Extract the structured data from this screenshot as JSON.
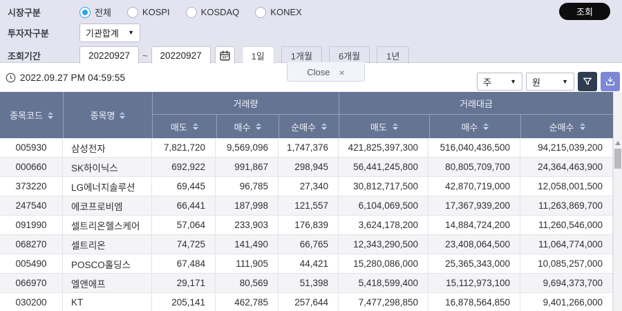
{
  "filters": {
    "market": {
      "label": "시장구분",
      "options": [
        {
          "label": "전체",
          "selected": true
        },
        {
          "label": "KOSPI",
          "selected": false
        },
        {
          "label": "KOSDAQ",
          "selected": false
        },
        {
          "label": "KONEX",
          "selected": false
        }
      ]
    },
    "investor": {
      "label": "투자자구분",
      "value": "기관합계"
    },
    "period": {
      "label": "조회기간",
      "start_date": "20220927",
      "separator": "~",
      "end_date": "20220927",
      "quick_buttons": [
        {
          "label": "1일",
          "active": true
        },
        {
          "label": "1개월",
          "active": false
        },
        {
          "label": "6개월",
          "active": false
        },
        {
          "label": "1년",
          "active": false
        }
      ]
    },
    "search_button_label": "조회"
  },
  "toolbar": {
    "timestamp": "2022.09.27 PM 04:59:55",
    "tab": {
      "label": "Close",
      "close_glyph": "×"
    },
    "unit_select_1": "주",
    "unit_select_2": "원"
  },
  "table": {
    "header": {
      "code": "종목코드",
      "name": "종목명",
      "volume_group": "거래량",
      "value_group": "거래대금",
      "sub_sell": "매도",
      "sub_buy": "매수",
      "sub_net": "순매수"
    },
    "rows": [
      {
        "code": "005930",
        "name": "삼성전자",
        "vol_sell": "7,821,720",
        "vol_buy": "9,569,096",
        "vol_net": "1,747,376",
        "val_sell": "421,825,397,300",
        "val_buy": "516,040,436,500",
        "val_net": "94,215,039,200"
      },
      {
        "code": "000660",
        "name": "SK하이닉스",
        "vol_sell": "692,922",
        "vol_buy": "991,867",
        "vol_net": "298,945",
        "val_sell": "56,441,245,800",
        "val_buy": "80,805,709,700",
        "val_net": "24,364,463,900"
      },
      {
        "code": "373220",
        "name": "LG에너지솔루션",
        "vol_sell": "69,445",
        "vol_buy": "96,785",
        "vol_net": "27,340",
        "val_sell": "30,812,717,500",
        "val_buy": "42,870,719,000",
        "val_net": "12,058,001,500"
      },
      {
        "code": "247540",
        "name": "에코프로비엠",
        "vol_sell": "66,441",
        "vol_buy": "187,998",
        "vol_net": "121,557",
        "val_sell": "6,104,069,500",
        "val_buy": "17,367,939,200",
        "val_net": "11,263,869,700"
      },
      {
        "code": "091990",
        "name": "셀트리온헬스케어",
        "vol_sell": "57,064",
        "vol_buy": "233,903",
        "vol_net": "176,839",
        "val_sell": "3,624,178,200",
        "val_buy": "14,884,724,200",
        "val_net": "11,260,546,000"
      },
      {
        "code": "068270",
        "name": "셀트리온",
        "vol_sell": "74,725",
        "vol_buy": "141,490",
        "vol_net": "66,765",
        "val_sell": "12,343,290,500",
        "val_buy": "23,408,064,500",
        "val_net": "11,064,774,000"
      },
      {
        "code": "005490",
        "name": "POSCO홀딩스",
        "vol_sell": "67,484",
        "vol_buy": "111,905",
        "vol_net": "44,421",
        "val_sell": "15,280,086,000",
        "val_buy": "25,365,343,000",
        "val_net": "10,085,257,000"
      },
      {
        "code": "066970",
        "name": "엘앤에프",
        "vol_sell": "29,171",
        "vol_buy": "80,569",
        "vol_net": "51,398",
        "val_sell": "5,418,599,400",
        "val_buy": "15,112,973,100",
        "val_net": "9,694,373,700"
      },
      {
        "code": "030200",
        "name": "KT",
        "vol_sell": "205,141",
        "vol_buy": "462,785",
        "vol_net": "257,644",
        "val_sell": "7,477,298,850",
        "val_buy": "16,878,564,850",
        "val_net": "9,401,266,000"
      }
    ]
  },
  "colors": {
    "panel_bg": "#e4e4f0",
    "accent_radio_blue": "#2ba3e8",
    "search_button_bg": "#0d0d0d",
    "table_header_bg": "#667494",
    "filter_icon_button_bg": "#303c50",
    "download_icon_button_bg": "#7c88d6",
    "row_stripe": "#f4f4f6"
  }
}
